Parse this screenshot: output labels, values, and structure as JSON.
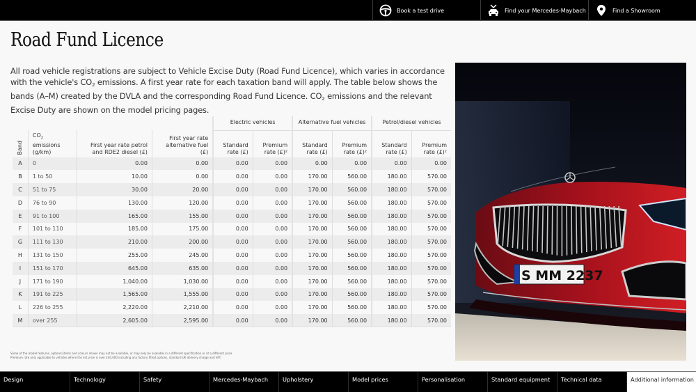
{
  "topbar": {
    "items": [
      {
        "label": "Book a test drive",
        "icon": "steering-wheel-icon"
      },
      {
        "label": "Find your Mercedes-Maybach",
        "icon": "car-search-icon"
      },
      {
        "label": "Find a Showroom",
        "icon": "location-pin-icon"
      }
    ]
  },
  "page": {
    "title": "Road Fund Licence",
    "intro_parts": {
      "p1": "All road vehicle registrations are subject to Vehicle Excise Duty (Road Fund Licence), which varies in accordance with the vehicle's CO",
      "sub": "2",
      "p2": " emissions. A first year rate for each taxation band will apply. The table below shows the bands (A–M) created by the DVLA and the corresponding Road Fund Licence. CO",
      "p3": " emissions and the relevant Excise Duty are shown on the model pricing pages."
    }
  },
  "table": {
    "group_headers": [
      "Electric vehicles",
      "Alternative fuel vehicles",
      "Petrol/diesel vehicles"
    ],
    "headers": {
      "band": "Band",
      "co2_a": "CO",
      "co2_sub": "2",
      "co2_b": " emissions",
      "co2_unit": "(g/km)",
      "fy_petrol_1": "First year rate petrol",
      "fy_petrol_2": "and RDE2 diesel (£)",
      "fy_alt_1": "First year rate",
      "fy_alt_2": "alternative fuel (£)",
      "std_1": "Standard",
      "std_2": "rate (£)",
      "prem_1": "Premium",
      "prem_2": "rate (£)²"
    },
    "rows": [
      {
        "band": "A",
        "co2": "0",
        "fy_petrol": "0.00",
        "fy_alt": "0.00",
        "ev_std": "0.00",
        "ev_prem": "0.00",
        "alt_std": "0.00",
        "alt_prem": "0.00",
        "pd_std": "0.00",
        "pd_prem": "0.00"
      },
      {
        "band": "B",
        "co2": "1 to 50",
        "fy_petrol": "10.00",
        "fy_alt": "0.00",
        "ev_std": "0.00",
        "ev_prem": "0.00",
        "alt_std": "170.00",
        "alt_prem": "560.00",
        "pd_std": "180.00",
        "pd_prem": "570.00"
      },
      {
        "band": "C",
        "co2": "51 to 75",
        "fy_petrol": "30.00",
        "fy_alt": "20.00",
        "ev_std": "0.00",
        "ev_prem": "0.00",
        "alt_std": "170.00",
        "alt_prem": "560.00",
        "pd_std": "180.00",
        "pd_prem": "570.00"
      },
      {
        "band": "D",
        "co2": "76 to 90",
        "fy_petrol": "130.00",
        "fy_alt": "120.00",
        "ev_std": "0.00",
        "ev_prem": "0.00",
        "alt_std": "170.00",
        "alt_prem": "560.00",
        "pd_std": "180.00",
        "pd_prem": "570.00"
      },
      {
        "band": "E",
        "co2": "91 to 100",
        "fy_petrol": "165.00",
        "fy_alt": "155.00",
        "ev_std": "0.00",
        "ev_prem": "0.00",
        "alt_std": "170.00",
        "alt_prem": "560.00",
        "pd_std": "180.00",
        "pd_prem": "570.00"
      },
      {
        "band": "F",
        "co2": "101 to 110",
        "fy_petrol": "185.00",
        "fy_alt": "175.00",
        "ev_std": "0.00",
        "ev_prem": "0.00",
        "alt_std": "170.00",
        "alt_prem": "560.00",
        "pd_std": "180.00",
        "pd_prem": "570.00"
      },
      {
        "band": "G",
        "co2": "111 to 130",
        "fy_petrol": "210.00",
        "fy_alt": "200.00",
        "ev_std": "0.00",
        "ev_prem": "0.00",
        "alt_std": "170.00",
        "alt_prem": "560.00",
        "pd_std": "180.00",
        "pd_prem": "570.00"
      },
      {
        "band": "H",
        "co2": "131 to 150",
        "fy_petrol": "255.00",
        "fy_alt": "245.00",
        "ev_std": "0.00",
        "ev_prem": "0.00",
        "alt_std": "170.00",
        "alt_prem": "560.00",
        "pd_std": "180.00",
        "pd_prem": "570.00"
      },
      {
        "band": "I",
        "co2": "151 to 170",
        "fy_petrol": "645.00",
        "fy_alt": "635.00",
        "ev_std": "0.00",
        "ev_prem": "0.00",
        "alt_std": "170.00",
        "alt_prem": "560.00",
        "pd_std": "180.00",
        "pd_prem": "570.00"
      },
      {
        "band": "J",
        "co2": "171 to 190",
        "fy_petrol": "1,040.00",
        "fy_alt": "1,030.00",
        "ev_std": "0.00",
        "ev_prem": "0.00",
        "alt_std": "170.00",
        "alt_prem": "560.00",
        "pd_std": "180.00",
        "pd_prem": "570.00"
      },
      {
        "band": "K",
        "co2": "191 to 225",
        "fy_petrol": "1,565.00",
        "fy_alt": "1,555.00",
        "ev_std": "0.00",
        "ev_prem": "0.00",
        "alt_std": "170.00",
        "alt_prem": "560.00",
        "pd_std": "180.00",
        "pd_prem": "570.00"
      },
      {
        "band": "L",
        "co2": "226 to 255",
        "fy_petrol": "2,220.00",
        "fy_alt": "2,210.00",
        "ev_std": "0.00",
        "ev_prem": "0.00",
        "alt_std": "170.00",
        "alt_prem": "560.00",
        "pd_std": "180.00",
        "pd_prem": "570.00"
      },
      {
        "band": "M",
        "co2": "over 255",
        "fy_petrol": "2,605.00",
        "fy_alt": "2,595.00",
        "ev_std": "0.00",
        "ev_prem": "0.00",
        "alt_std": "170.00",
        "alt_prem": "560.00",
        "pd_std": "180.00",
        "pd_prem": "570.00"
      }
    ]
  },
  "footnote": {
    "line1": "Some of the model features, optional items and colours shown may not be available, or may only be available in a different specification or at a different price.",
    "line2": "Premium rate only applicable to vehicles where the list price is over £40,000 including any factory fitted options, standard UK delivery charge and VAT."
  },
  "photo": {
    "plate": "S MM 2237",
    "alt": "Mercedes-Maybach front grille"
  },
  "bottomnav": {
    "items": [
      {
        "label": "Design"
      },
      {
        "label": "Technology"
      },
      {
        "label": "Safety"
      },
      {
        "label": "Mercedes-Maybach"
      },
      {
        "label": "Upholstery"
      },
      {
        "label": "Model prices"
      },
      {
        "label": "Personalisation"
      },
      {
        "label": "Standard equipment"
      },
      {
        "label": "Technical data"
      },
      {
        "label": "Additional information",
        "active": true
      }
    ]
  }
}
